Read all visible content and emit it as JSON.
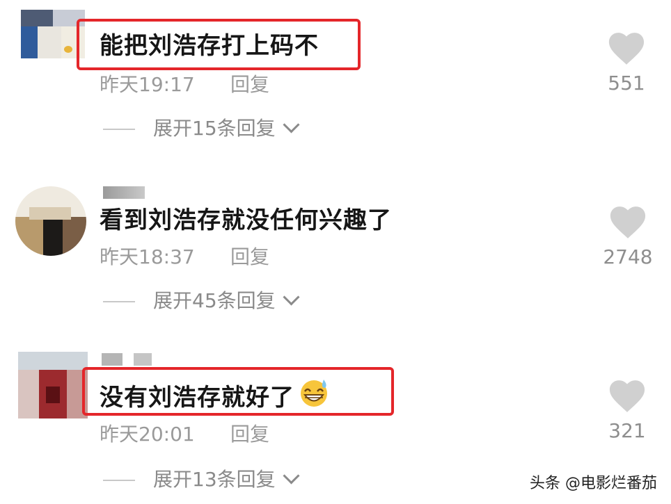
{
  "comments": [
    {
      "text": "能把刘浩存打上码不",
      "time": "昨天19:17",
      "reply_label": "回复",
      "expand_label": "展开15条回复",
      "likes": "551",
      "highlighted": true
    },
    {
      "text": "看到刘浩存就没任何兴趣了",
      "time": "昨天18:37",
      "reply_label": "回复",
      "expand_label": "展开45条回复",
      "likes": "2748",
      "highlighted": false
    },
    {
      "text": "没有刘浩存就好了",
      "time": "昨天20:01",
      "reply_label": "回复",
      "expand_label": "展开13条回复",
      "likes": "321",
      "highlighted": true,
      "emoji": "grinning-sweat-emoji"
    }
  ],
  "watermark": "头条 @电影烂番茄",
  "colors": {
    "highlight": "#e4262a",
    "heart": "#d0d0d0",
    "meta_text": "#9a9a9a"
  }
}
